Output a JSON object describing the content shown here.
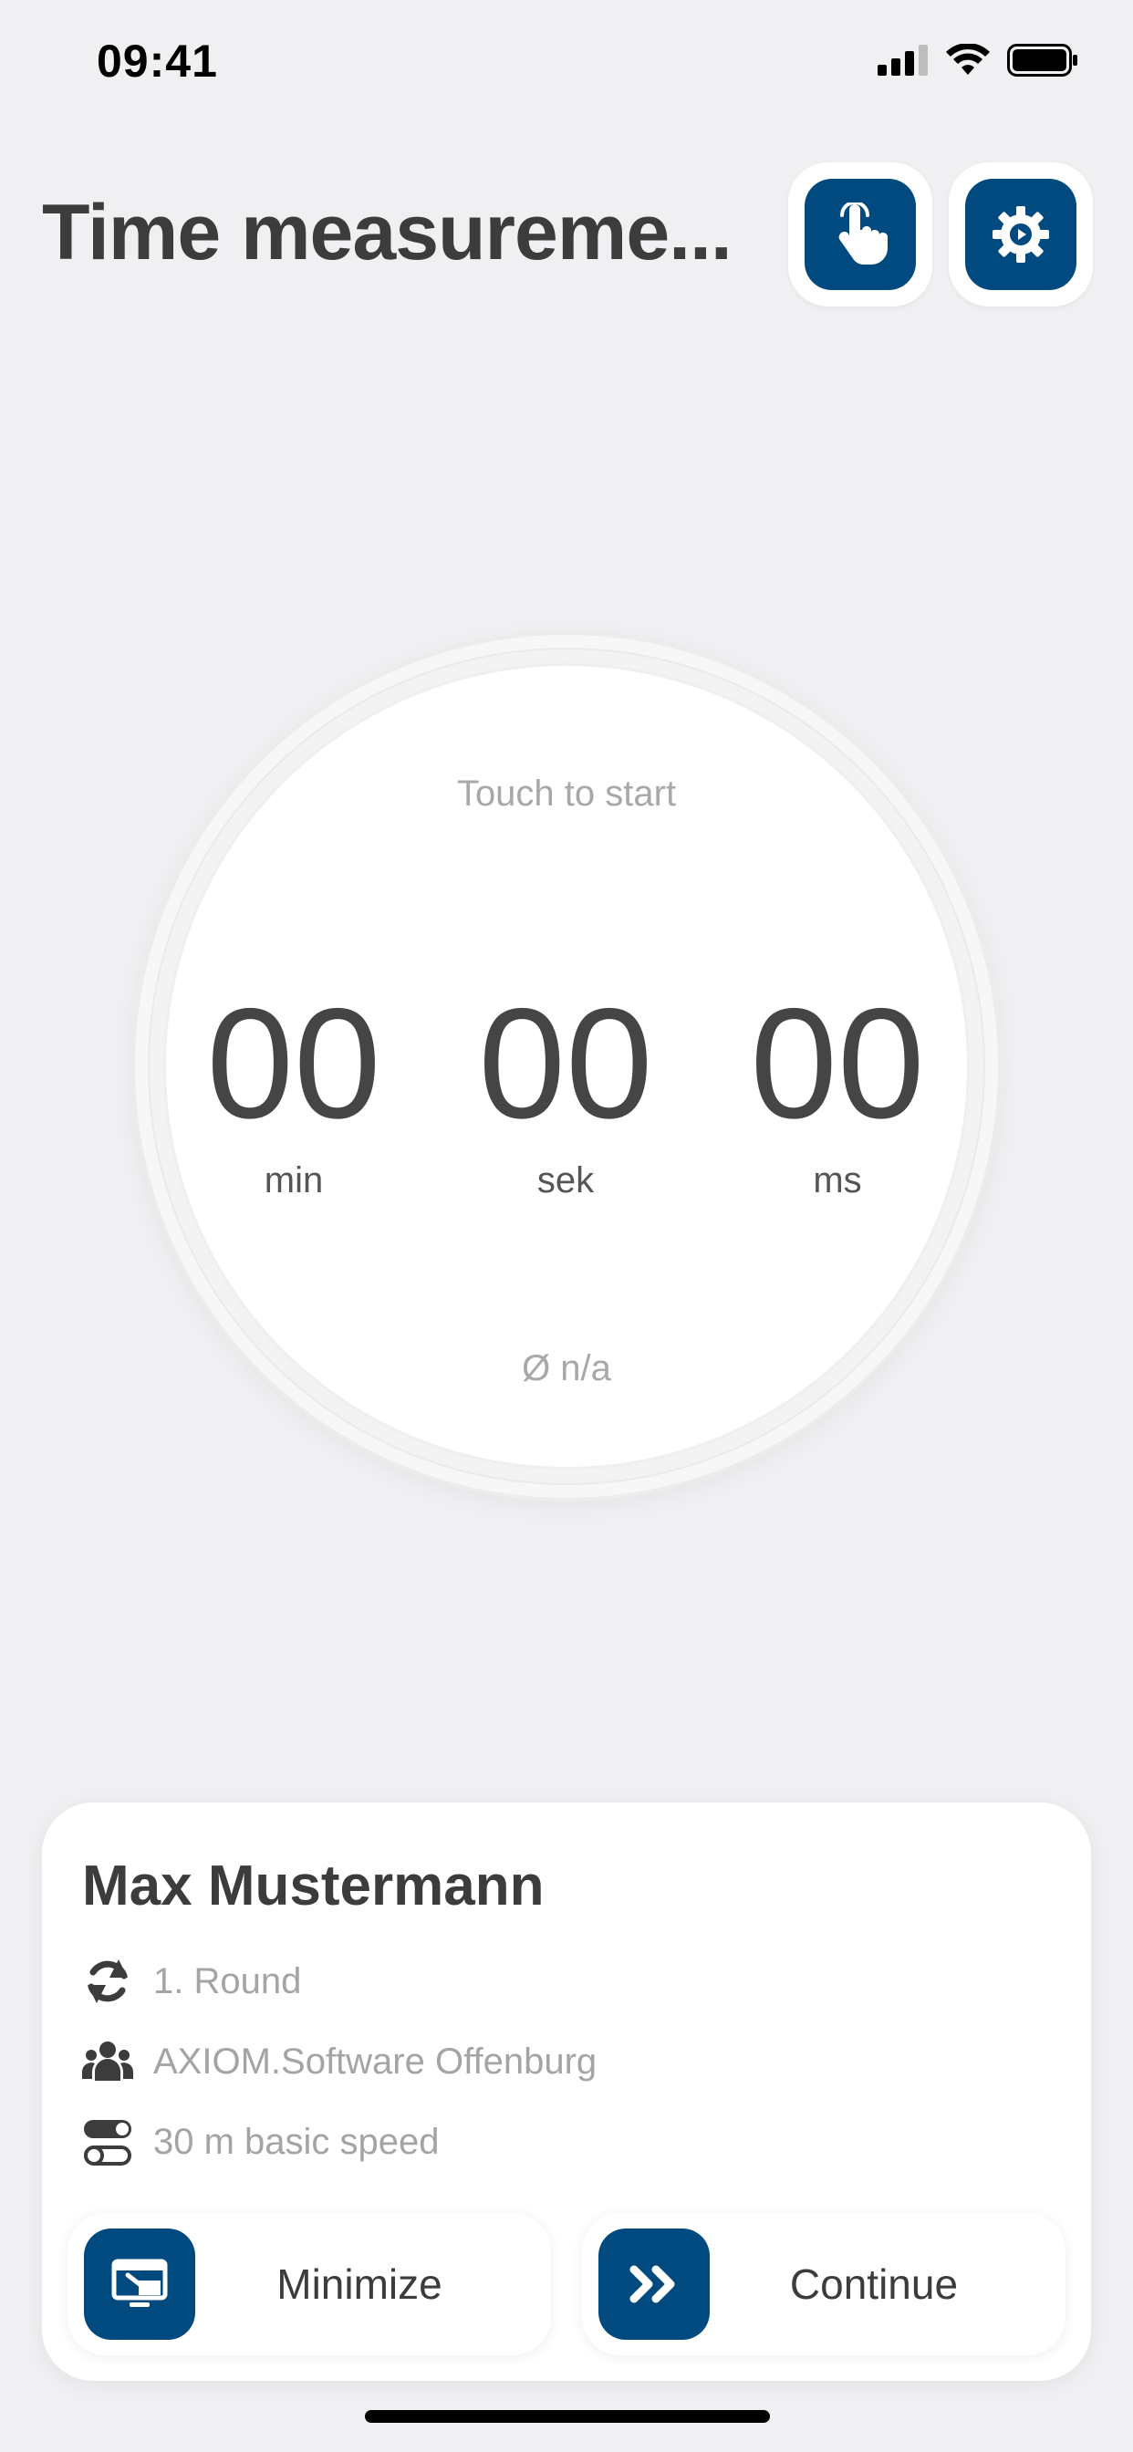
{
  "status_bar": {
    "time": "09:41"
  },
  "header": {
    "title": "Time measureme..."
  },
  "timer": {
    "hint": "Touch to start",
    "minutes": "00",
    "seconds": "00",
    "milliseconds": "00",
    "unit_min": "min",
    "unit_sek": "sek",
    "unit_ms": "ms",
    "average": "Ø n/a"
  },
  "card": {
    "name": "Max Mustermann",
    "round": "1. Round",
    "team": "AXIOM.Software Offenburg",
    "discipline": "30 m basic speed",
    "minimize_label": "Minimize",
    "continue_label": "Continue"
  },
  "colors": {
    "accent": "#004a7f",
    "background": "#f0f0f3",
    "text": "#3c3c3c",
    "muted": "#a4a4a4"
  }
}
